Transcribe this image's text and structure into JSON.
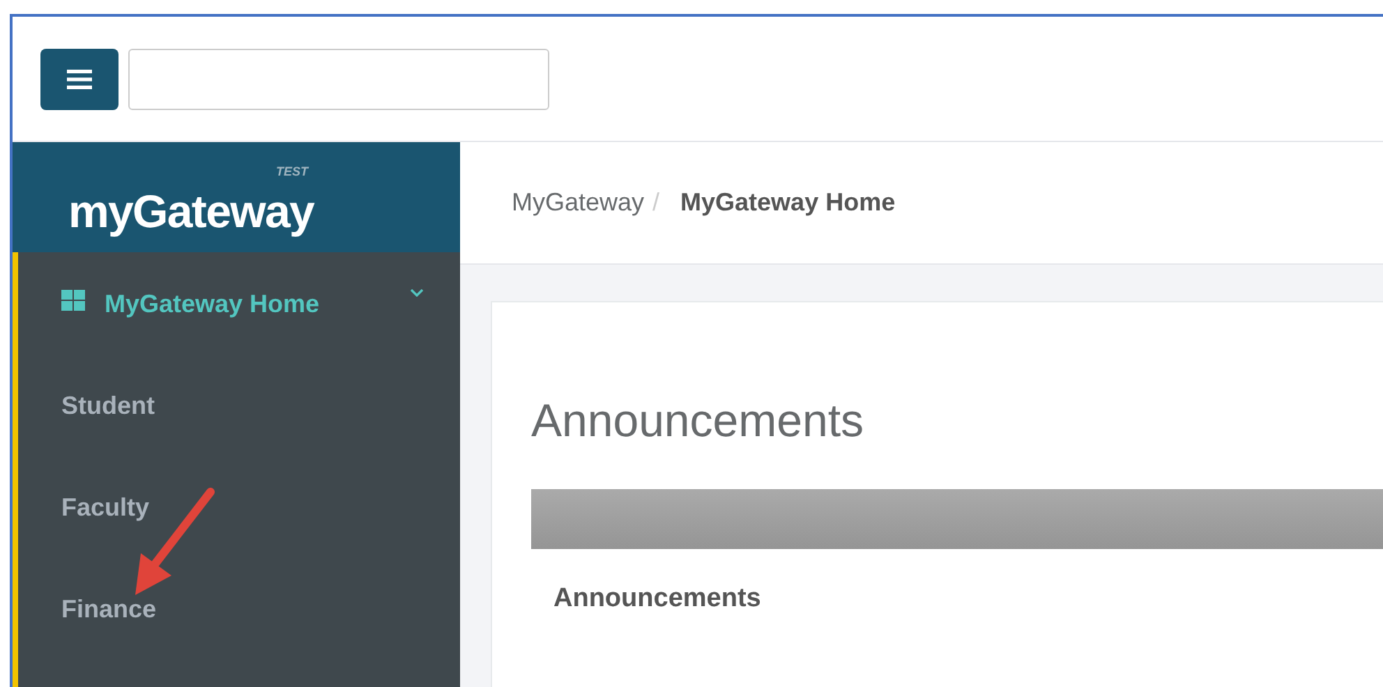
{
  "logo": {
    "name": "myGateway",
    "badge": "TEST"
  },
  "sidebar": {
    "items": [
      {
        "label": "MyGateway Home",
        "selected": true,
        "expanded": false
      },
      {
        "label": "Student",
        "selected": false
      },
      {
        "label": "Faculty",
        "selected": false
      },
      {
        "label": "Finance",
        "selected": false
      }
    ]
  },
  "breadcrumb_separator": "/",
  "breadcrumb": [
    {
      "label": "MyGateway",
      "current": false
    },
    {
      "label": "MyGateway Home",
      "current": true
    }
  ],
  "content": {
    "title": "Announcements",
    "panel": {
      "heading": "Announcements"
    }
  }
}
